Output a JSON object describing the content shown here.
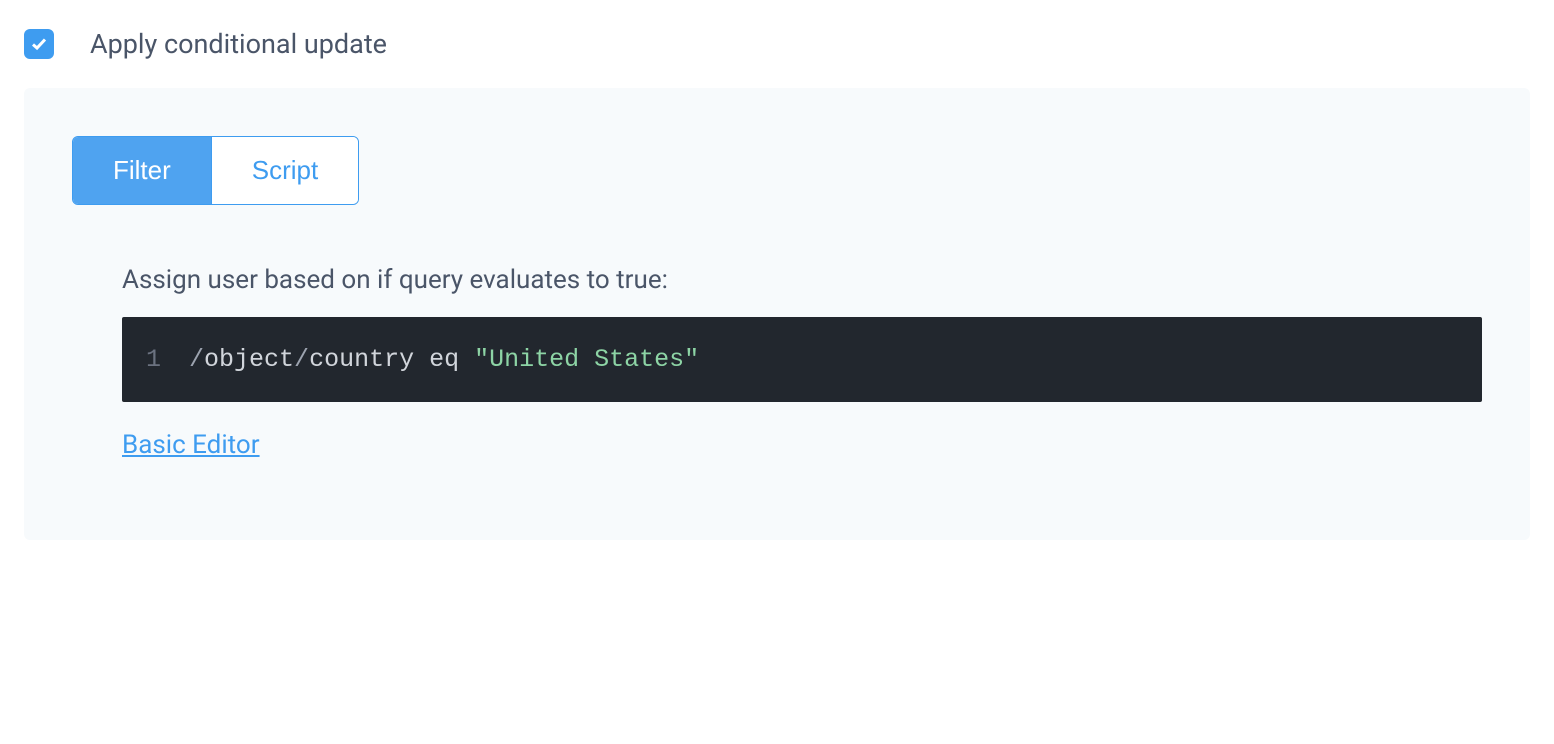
{
  "checkbox": {
    "checked": true,
    "label": "Apply conditional update"
  },
  "tabs": {
    "filter": "Filter",
    "script": "Script",
    "active": "filter"
  },
  "content": {
    "instruction": "Assign user based on if query evaluates to true:",
    "code": {
      "line_number": "1",
      "tokens": {
        "slash1": "/",
        "object": "object",
        "slash2": "/",
        "country": "country",
        "space1": " ",
        "eq": "eq",
        "space2": " ",
        "string": "\"United States\""
      }
    },
    "basic_editor_link": "Basic Editor"
  },
  "colors": {
    "accent": "#3e9cf0",
    "panel_bg": "#f7fafc",
    "text": "#4a5568",
    "code_bg": "#22272e",
    "code_string": "#8dd4a5"
  }
}
